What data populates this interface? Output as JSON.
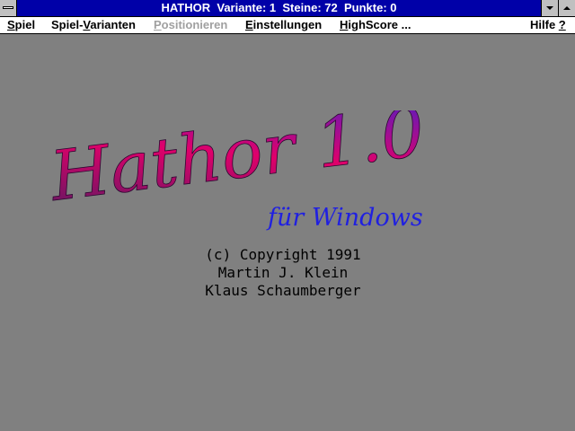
{
  "titlebar": {
    "title": "HATHOR  Variante: 1  Steine: 72  Punkte: 0"
  },
  "menu": {
    "items": [
      {
        "pre": "",
        "ul": "S",
        "post": "piel",
        "disabled": false
      },
      {
        "pre": "Spiel-",
        "ul": "V",
        "post": "arianten",
        "disabled": false
      },
      {
        "pre": "",
        "ul": "P",
        "post": "ositionieren",
        "disabled": true
      },
      {
        "pre": "",
        "ul": "E",
        "post": "instellungen",
        "disabled": false
      },
      {
        "pre": "",
        "ul": "H",
        "post": "ighScore ...",
        "disabled": false
      }
    ],
    "help": {
      "pre": "Hilfe ",
      "ul": "?",
      "post": ""
    }
  },
  "logo": {
    "title": "Hathor 1.0",
    "subtitle": "für Windows",
    "colors": {
      "start": "#5a1a60",
      "mid": "#e0006a",
      "end": "#4a20c8",
      "subtitle": "#2020e0"
    }
  },
  "credits": {
    "line1": "(c) Copyright 1991",
    "line2": "Martin J. Klein",
    "line3": "Klaus Schaumberger"
  },
  "colors": {
    "titlebar": "#0000a8",
    "menubar": "#ffffff",
    "background": "#808080",
    "disabled": "#a0a0a0"
  }
}
